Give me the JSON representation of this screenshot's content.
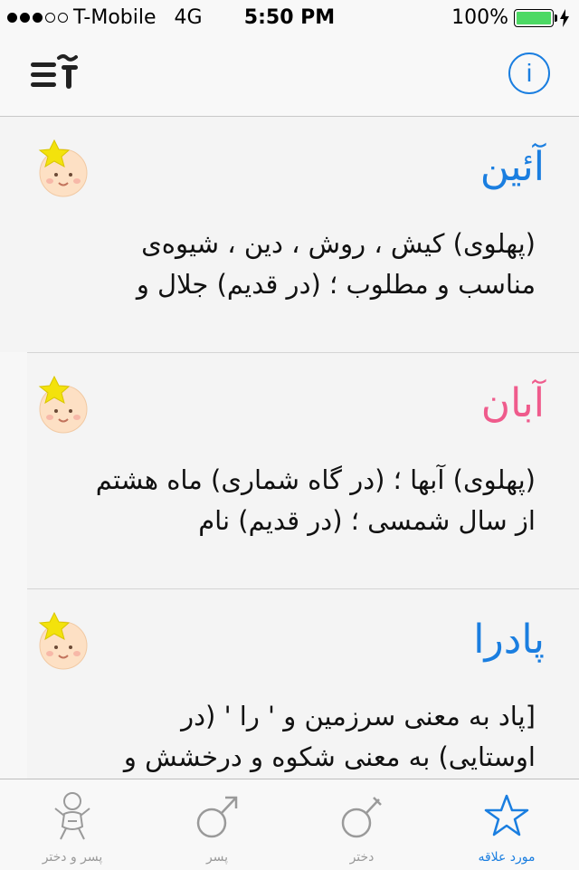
{
  "status": {
    "carrier": "T-Mobile",
    "network": "4G",
    "time": "5:50 PM",
    "battery": "100%"
  },
  "navbar": {
    "info_label": "i"
  },
  "names": [
    {
      "name": "آئین",
      "gender_color": "#1a7ee0",
      "description": "(پهلوی) کیش ، روش ، دین ، شیوه‌ی مناسب و مطلوب ؛ (در قدیم) جلال و"
    },
    {
      "name": "آبان",
      "gender_color": "#ef5b8c",
      "description": "(پهلوی) آبها ؛ (در گاه شماری) ماه هشتم از سال شمسی ؛ (در قدیم) نام"
    },
    {
      "name": "پادرا",
      "gender_color": "#1a7ee0",
      "description": "[پاد به معنی سرزمین و ' را ' (در اوستایی) به معنی شکوه و درخشش و"
    }
  ],
  "tabs": [
    {
      "label": "پسر و دختر",
      "icon": "baby-icon"
    },
    {
      "label": "پسر",
      "icon": "male-icon"
    },
    {
      "label": "دختر",
      "icon": "female-icon"
    },
    {
      "label": "مورد علاقه",
      "icon": "star-icon"
    }
  ],
  "colors": {
    "accent": "#1a7ee0",
    "girl": "#ef5b8c",
    "battery": "#4cd964"
  }
}
